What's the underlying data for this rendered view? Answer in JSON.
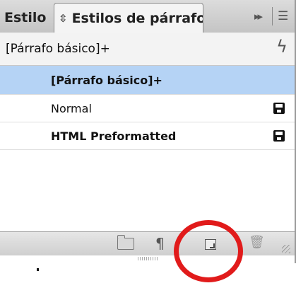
{
  "tabs": {
    "inactive_label": "Estilo",
    "active_label": "Estilos de párrafo"
  },
  "header": {
    "current_style": "[Párrafo básico]+"
  },
  "styles": [
    {
      "label": "[Párrafo básico]+",
      "selected": true,
      "saved_icon": false
    },
    {
      "label": "Normal",
      "selected": false,
      "saved_icon": true
    },
    {
      "label": "HTML Preformatted",
      "selected": false,
      "saved_icon": true
    }
  ],
  "icons": {
    "updown": "⇳",
    "expand": "▸▸",
    "menu": "☰",
    "bolt": "ϟ",
    "pilcrow": "¶",
    "trash": "🗑"
  },
  "colors": {
    "selection": "#b5d3f5",
    "highlight_circle": "#e11b1b"
  }
}
